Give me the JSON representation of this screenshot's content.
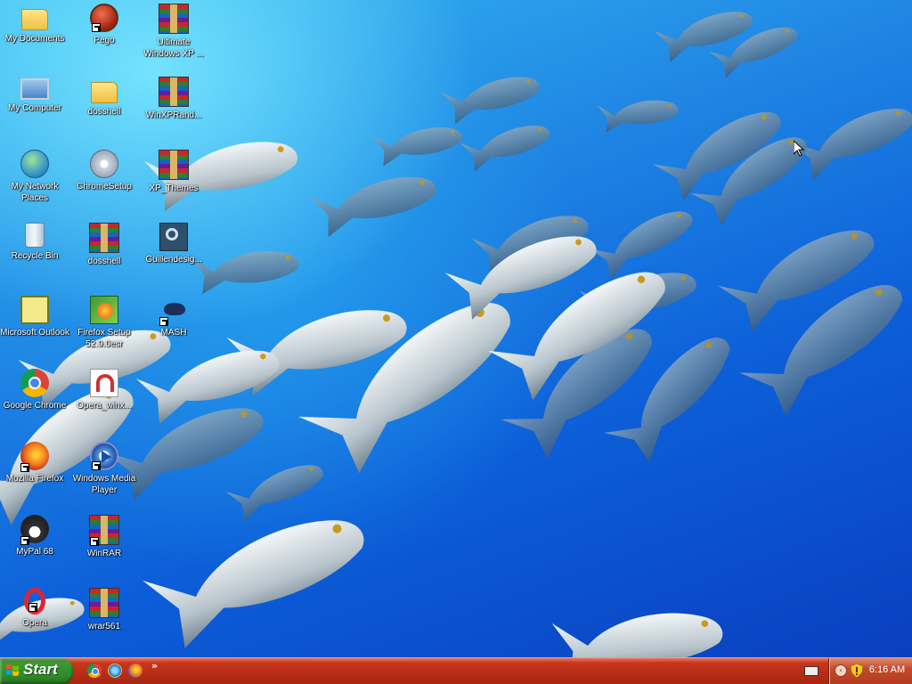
{
  "desktop": {
    "icons": [
      {
        "label": "My Documents"
      },
      {
        "label": "Pego"
      },
      {
        "label": "Ultimate Windows XP ..."
      },
      {
        "label": "My Computer"
      },
      {
        "label": "dosshell"
      },
      {
        "label": "WinXPRand..."
      },
      {
        "label": "My Network Places"
      },
      {
        "label": "ChromeSetup"
      },
      {
        "label": "XP_Themes"
      },
      {
        "label": "Recycle Bin"
      },
      {
        "label": "dosshell"
      },
      {
        "label": "Guillendesig..."
      },
      {
        "label": "Microsoft Outlook"
      },
      {
        "label": "Firefox Setup 52.9.0esr"
      },
      {
        "label": "MASH"
      },
      {
        "label": "Google Chrome"
      },
      {
        "label": "Opera_winx..."
      },
      {
        "label": "Mozilla Firefox"
      },
      {
        "label": "Windows Media Player"
      },
      {
        "label": "MyPal 68"
      },
      {
        "label": "WinRAR"
      },
      {
        "label": "Opera"
      },
      {
        "label": "wrar561"
      }
    ]
  },
  "taskbar": {
    "start_label": "Start",
    "quick_launch_chevron": "»",
    "tray_chevron": "‹",
    "clock": "6:16 AM"
  },
  "colors": {
    "taskbar": "#b92d17",
    "start_button": "#2f8a2a",
    "wallpaper": "#1f86e4"
  }
}
